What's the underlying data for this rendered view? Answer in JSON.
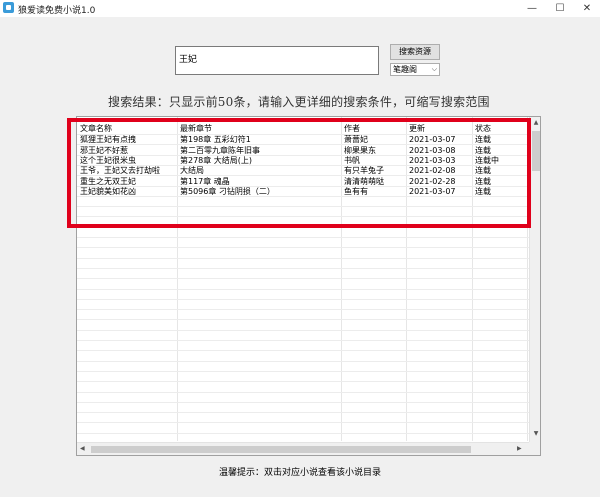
{
  "window": {
    "title": "狼爱读免费小说1.0",
    "controls": {
      "minimize": "—",
      "maximize": "☐",
      "close": "✕"
    },
    "icon": "book-app-icon"
  },
  "search": {
    "value": "王妃",
    "button_label": "搜索资源",
    "source_selected": "笔趣阁"
  },
  "result_notice": "搜索结果：只显示前50条，请输入更详细的搜索条件，可缩写搜索范围",
  "table": {
    "columns": [
      "文章名称",
      "最新章节",
      "作者",
      "更新",
      "状态"
    ],
    "rows": [
      [
        "狐狸王妃有点拽",
        "第198章 五彩幻符1",
        "萧蔷妃",
        "2021-03-07",
        "连载"
      ],
      [
        "邪王妃不好惹",
        "第二百零九章陈年旧事",
        "柳果果东",
        "2021-03-08",
        "连载"
      ],
      [
        "这个王妃很米虫",
        "第278章 大结局(上)",
        "书帆",
        "2021-03-03",
        "连载中"
      ],
      [
        "王爷，王妃又去打劫啦",
        "大结局",
        "有只羊兔子",
        "2021-02-08",
        "连载"
      ],
      [
        "重生之无双王妃",
        "第117章 魂晶",
        "清清萌萌哒",
        "2021-02-28",
        "连载"
      ],
      [
        "王妃貌美如花凶",
        "第5096章 刁钻阴损（二）",
        "鱼有有",
        "2021-03-07",
        "连载"
      ]
    ]
  },
  "footer_tip": "温馨提示：双击对应小说查看该小说目录",
  "colors": {
    "highlight": "#e0001b",
    "background": "#f0f0f0"
  }
}
